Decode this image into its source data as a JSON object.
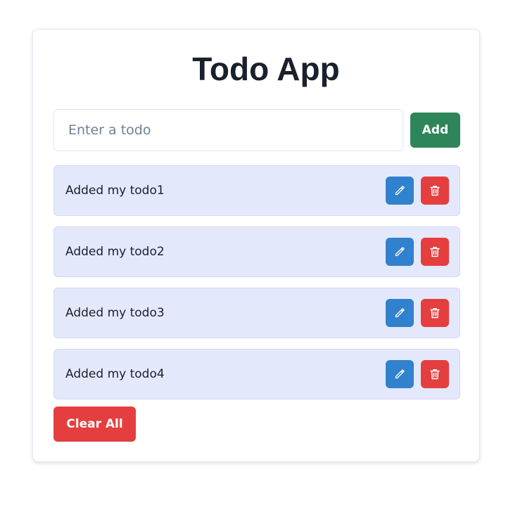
{
  "app": {
    "title": "Todo App"
  },
  "input": {
    "value": "",
    "placeholder": "Enter a todo"
  },
  "buttons": {
    "add_label": "Add",
    "clear_all_label": "Clear All"
  },
  "todos": [
    {
      "text": "Added my todo1",
      "edit_icon": "pencil-icon",
      "delete_icon": "trash-icon"
    },
    {
      "text": "Added my todo2",
      "edit_icon": "pencil-icon",
      "delete_icon": "trash-icon"
    },
    {
      "text": "Added my todo3",
      "edit_icon": "pencil-icon",
      "delete_icon": "trash-icon"
    },
    {
      "text": "Added my todo4",
      "edit_icon": "pencil-icon",
      "delete_icon": "trash-icon"
    }
  ],
  "colors": {
    "add_button": "#2f855a",
    "edit_button": "#3182ce",
    "delete_button": "#e53e3e",
    "todo_background": "#e4e8fb"
  }
}
